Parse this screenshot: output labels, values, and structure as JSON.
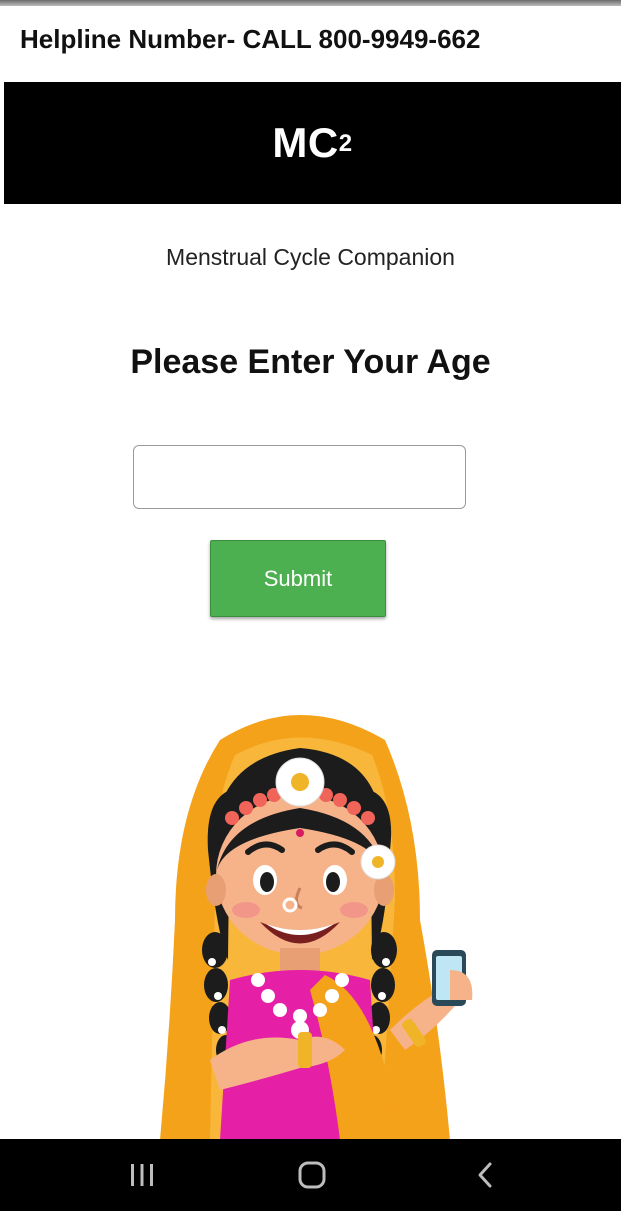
{
  "helpline": {
    "text": "Helpline Number- CALL 800-9949-662"
  },
  "header": {
    "logo_main": "MC",
    "logo_sup": "2"
  },
  "subtitle": "Menstrual Cycle Companion",
  "form": {
    "heading": "Please Enter Your Age",
    "age_input": {
      "value": "",
      "placeholder": ""
    },
    "submit_label": "Submit"
  },
  "illustration": {
    "icon": "girl-with-phone-illustration"
  },
  "navbar": {
    "items": [
      {
        "icon": "recent-apps-icon"
      },
      {
        "icon": "home-icon"
      },
      {
        "icon": "back-icon"
      }
    ]
  },
  "colors": {
    "header_bg": "#000000",
    "submit_bg": "#4caf50",
    "navbar_bg": "#000000",
    "saree": "#f5a21b",
    "blouse": "#e51fa6"
  }
}
